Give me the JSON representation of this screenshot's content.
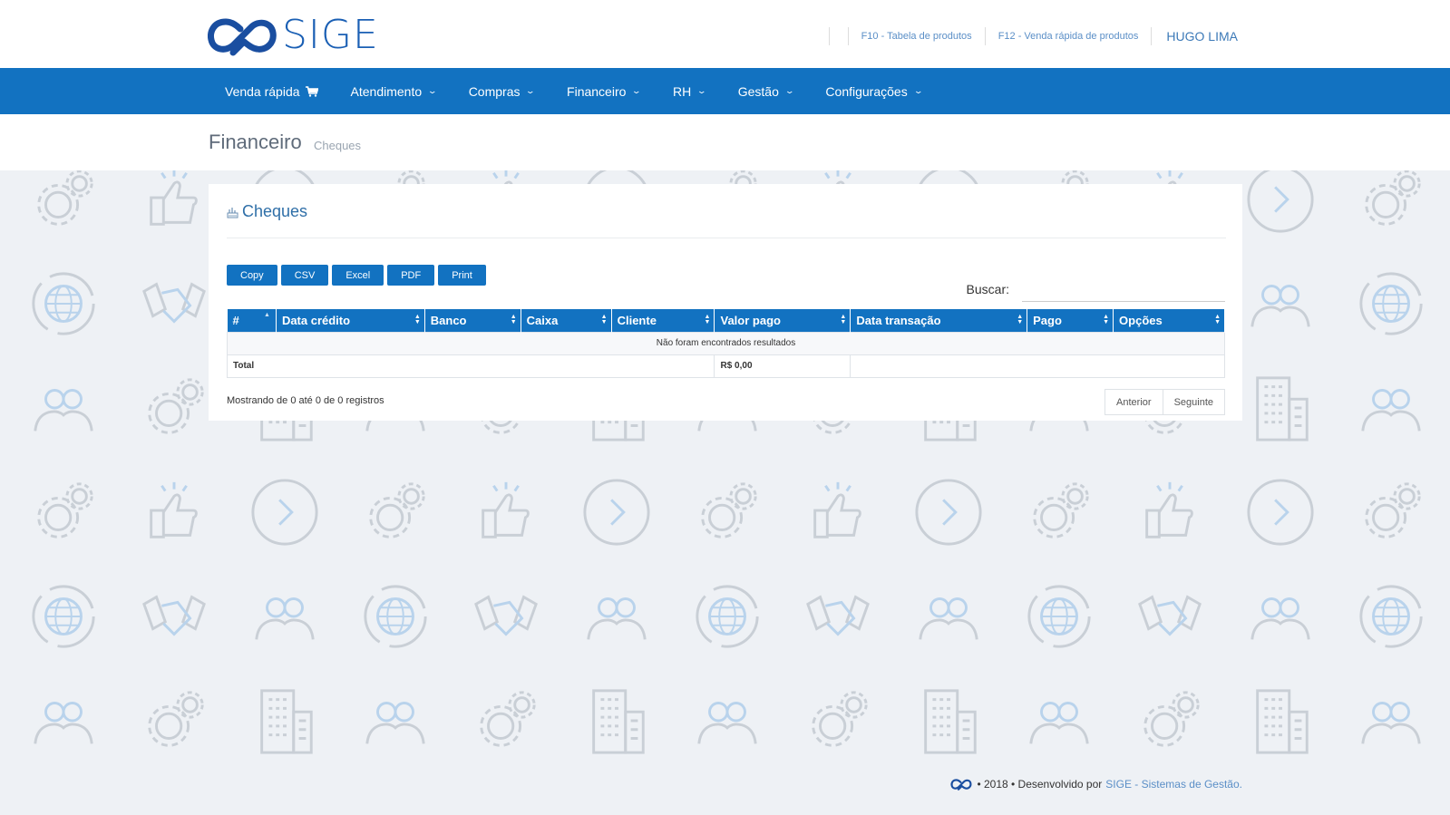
{
  "header": {
    "logo_text": "SIGE",
    "links": [
      "F10 - Tabela de produtos",
      "F12 - Venda rápida de produtos"
    ],
    "user": "HUGO LIMA"
  },
  "nav": {
    "items": [
      {
        "label": "Venda rápida",
        "icon": "cart-icon"
      },
      {
        "label": "Atendimento",
        "icon": "chevron-down-icon"
      },
      {
        "label": "Compras",
        "icon": "chevron-down-icon"
      },
      {
        "label": "Financeiro",
        "icon": "chevron-down-icon"
      },
      {
        "label": "RH",
        "icon": "chevron-down-icon"
      },
      {
        "label": "Gestão",
        "icon": "chevron-down-icon"
      },
      {
        "label": "Configurações",
        "icon": "chevron-down-icon"
      }
    ]
  },
  "page": {
    "title": "Financeiro",
    "subtitle": "Cheques"
  },
  "card": {
    "title": "Cheques",
    "buttons": [
      "Copy",
      "CSV",
      "Excel",
      "PDF",
      "Print"
    ],
    "search_label": "Buscar:",
    "search_value": ""
  },
  "table": {
    "columns": [
      "#",
      "Data crédito",
      "Banco",
      "Caixa",
      "Cliente",
      "Valor pago",
      "Data transação",
      "Pago",
      "Opções"
    ],
    "empty_message": "Não foram encontrados resultados",
    "total_label": "Total",
    "total_value": "R$ 0,00"
  },
  "pagination": {
    "info": "Mostrando de 0 até 0 de 0 registros",
    "prev": "Anterior",
    "next": "Seguinte"
  },
  "footer": {
    "text": "• 2018 • Desenvolvido por",
    "link": "SIGE - Sistemas de Gestão."
  },
  "colors": {
    "primary": "#1272c1",
    "background": "#eef1f5",
    "link": "#5b8fc7"
  }
}
